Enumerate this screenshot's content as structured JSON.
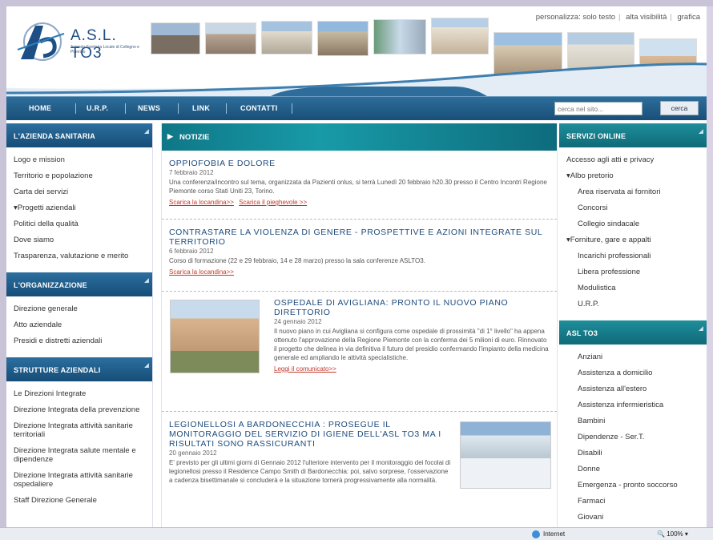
{
  "header": {
    "logo_name": "A.S.L. TO3",
    "logo_sub": "Azienda Sanitaria Locale di Collegno e Pinerolo",
    "persona_label": "personalizza:",
    "persona_links": [
      "solo testo",
      "alta visibilità",
      "grafica"
    ]
  },
  "nav": {
    "items": [
      "HOME",
      "U.R.P.",
      "NEWS",
      "LINK",
      "CONTATTI"
    ],
    "search_placeholder": "cerca nel sito...",
    "search_button": "cerca"
  },
  "left": {
    "boxes": [
      {
        "title": "L'AZIENDA SANITARIA",
        "items": [
          "Logo e mission",
          "Territorio e popolazione",
          "Carta dei servizi",
          "▾Progetti aziendali",
          "Politici della qualità",
          "Dove siamo",
          "Trasparenza, valutazione e merito"
        ]
      },
      {
        "title": "L'ORGANIZZAZIONE",
        "items": [
          "Direzione generale",
          "Atto aziendale",
          "Presidi e distretti aziendali"
        ]
      },
      {
        "title": "STRUTTURE AZIENDALI",
        "items": [
          "Le Direzioni Integrate",
          "Direzione Integrata della prevenzione",
          "Direzione Integrata attività sanitarie territoriali",
          "Direzione Integrata salute mentale e dipendenze",
          "Direzione Integrata attività sanitarie ospedaliere",
          "Staff Direzione Generale"
        ]
      }
    ]
  },
  "news": {
    "title": "NOTIZIE",
    "items": [
      {
        "title": "OPPIOFOBIA E DOLORE",
        "date": "7 febbraio 2012",
        "text": "Una conferenza/incontro sul tema, organizzata da Pazienti onlus, si terrà Lunedì 20 febbraio h20.30 presso il Centro Incontri Regione Piemonte corso Stati Uniti 23, Torino.",
        "links": [
          "Scarica la locandina>>",
          "Scarica il pieghevole >>"
        ]
      },
      {
        "title": "CONTRASTARE LA VIOLENZA DI GENERE - PROSPETTIVE E AZIONI INTEGRATE SUL TERRITORIO",
        "date": "6 febbraio 2012",
        "text": "Corso di formazione (22 e 29 febbraio, 14 e 28 marzo) presso la sala conferenze ASLTO3.",
        "links": [
          "Scarica la locandina>>"
        ]
      },
      {
        "title": "OSPEDALE DI AVIGLIANA: PRONTO IL NUOVO PIANO DIRETTORIO",
        "date": "24 gennaio 2012",
        "text": "Il nuovo piano in cui Avigliana si configura come ospedale di prossimità \"di 1° livello\" ha appena ottenuto l'approvazione della Regione Piemonte con la conferma dei 5 milioni di euro. Rinnovato il progetto che delinea in via definitiva il futuro del presidio confermando l'impianto della medicina generale ed ampliando le attività specialistiche.",
        "links": [
          "Leggi il comunicato>>"
        ]
      },
      {
        "title": "LEGIONELLOSI A BARDONECCHIA : PROSEGUE IL MONITORAGGIO DEL SERVIZIO DI IGIENE DELL'ASL TO3 MA I RISULTATI SONO RASSICURANTI",
        "date": "20 gennaio 2012",
        "text": "E' previsto per gli ultimi giorni di Gennaio 2012 l'ulteriore intervento per il monitoraggio dei focolai di legionellosi presso il Residence Campo Smith di Bardonecchia: poi, salvo sorprese, l'osservazione a cadenza bisettimanale si concluderà e la situazione tornerà progressivamente alla normalità.",
        "links": []
      }
    ]
  },
  "right": {
    "boxes": [
      {
        "title": "SERVIZI ONLINE",
        "items": [
          "Accesso agli atti e privacy",
          "▾Albo pretorio",
          "Area riservata ai fornitori",
          "Concorsi",
          "Collegio sindacale",
          "▾Forniture, gare e appalti",
          "Incarichi professionali",
          "Libera professione",
          "Modulistica",
          "U.R.P."
        ]
      },
      {
        "title": "ASL TO3",
        "items": [
          "Anziani",
          "Assistenza a domicilio",
          "Assistenza all'estero",
          "Assistenza infermieristica",
          "Bambini",
          "Dipendenze - Ser.T.",
          "Disabili",
          "Donne",
          "Emergenza - pronto soccorso",
          "Farmaci",
          "Giovani"
        ]
      }
    ]
  },
  "status": {
    "zone": "Internet",
    "zoom": "100%"
  },
  "colors": {
    "nav_blue": "#1f5f8f",
    "teal": "#12818f",
    "title_blue": "#1c4a7c",
    "link_red": "#c0392b"
  }
}
